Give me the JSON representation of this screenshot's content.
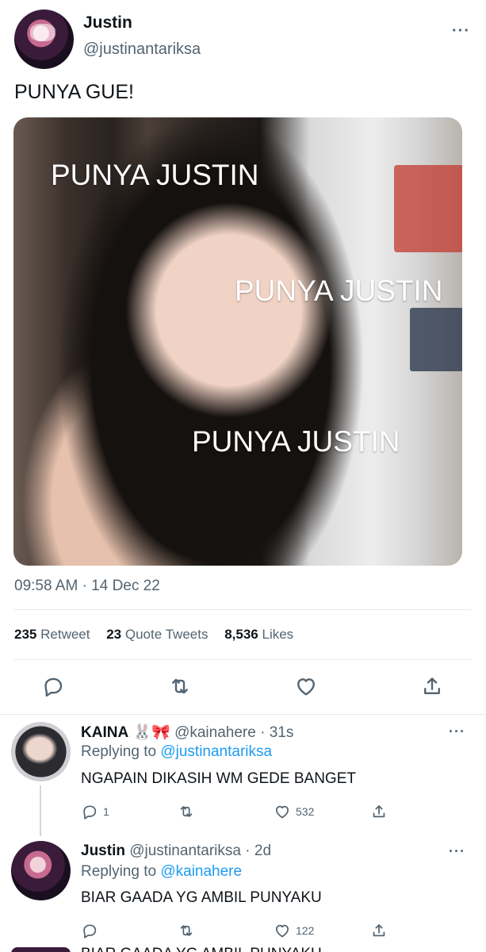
{
  "tweet": {
    "author_name": "Justin",
    "author_handle": "@justinantariksa",
    "more_icon": "···",
    "text": "PUNYA GUE!",
    "image": {
      "watermarks": [
        "PUNYA JUSTIN",
        "PUNYA JUSTIN",
        "PUNYA JUSTIN"
      ]
    },
    "timestamp": "09:58 AM · 14 Dec 22",
    "stats": {
      "retweets": "235",
      "retweets_label": "Retweet",
      "quotes": "23",
      "quotes_label": "Quote Tweets",
      "likes": "8,536",
      "likes_label": "Likes"
    },
    "actions": [
      "reply-icon",
      "retweet-icon",
      "like-icon",
      "share-icon"
    ]
  },
  "replies": [
    {
      "name": "KAINA",
      "emoji": "🐰🎀",
      "handle": "@kainahere",
      "time": "· 31s",
      "replying_prefix": "Replying to",
      "replying_to": "@justinantariksa",
      "text": "NGAPAIN DIKASIH WM GEDE BANGET",
      "reply_count": "1",
      "like_count": "532",
      "more_icon": "···"
    },
    {
      "name": "Justin",
      "handle": "@justinantariksa",
      "time": "· 2d",
      "replying_prefix": "Replying to",
      "replying_to": "@kainahere",
      "text": "BIAR GAADA YG AMBIL PUNYAKU",
      "reply_count": "",
      "like_count": "122",
      "more_icon": "···"
    }
  ],
  "next_reply_peek": "BIAR GAADA YG AMBIL PUNYAKU",
  "colors": {
    "accent": "#1d9bf0",
    "text": "#0f1419",
    "secondary": "#536471",
    "divider": "#e7e9ea"
  }
}
